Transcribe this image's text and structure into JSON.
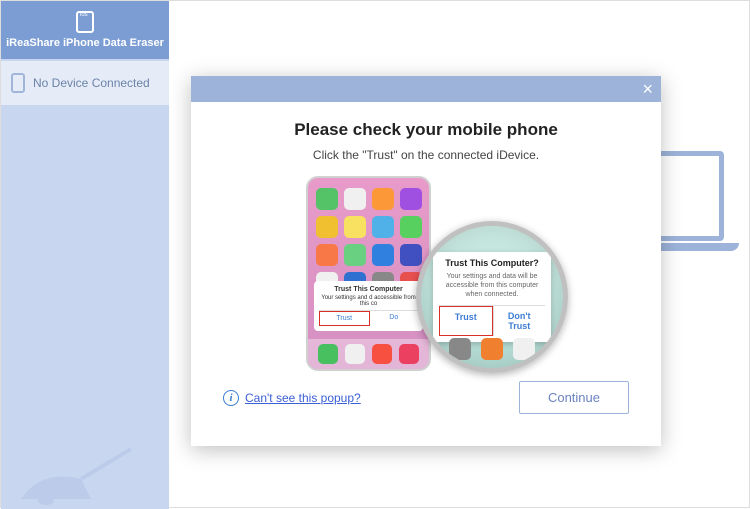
{
  "app": {
    "title": "iReaShare iPhone Data Eraser"
  },
  "sidebar": {
    "device_status": "No Device Connected"
  },
  "modal": {
    "title": "Please check your mobile phone",
    "subtitle": "Click the \"Trust\" on the connected iDevice.",
    "magnifier": {
      "title": "Trust This Computer?",
      "text": "Your settings and data will be accessible from this computer when connected.",
      "trust": "Trust",
      "dont_trust": "Don't Trust"
    },
    "phone_popup": {
      "title": "Trust This Computer",
      "text": "Your settings and d accessible from this co",
      "trust": "Trust",
      "dont": "Do"
    },
    "help_link": "Can't see this popup?",
    "continue": "Continue"
  },
  "colors": {
    "apps": [
      "#54c267",
      "#f0f0f0",
      "#fc9838",
      "#a050e0",
      "#f0c030",
      "#f8e060",
      "#50b0e8",
      "#58d060",
      "#f87848",
      "#68d080",
      "#3080e0",
      "#4050c0",
      "#f0f0f0",
      "#3070d0",
      "#888888",
      "#e85050"
    ],
    "dock": [
      "#48c060",
      "#f0f0f0",
      "#f85040",
      "#ec4060"
    ],
    "mag_dock": [
      "#888888",
      "#f08030",
      "#f0f0f0"
    ]
  }
}
